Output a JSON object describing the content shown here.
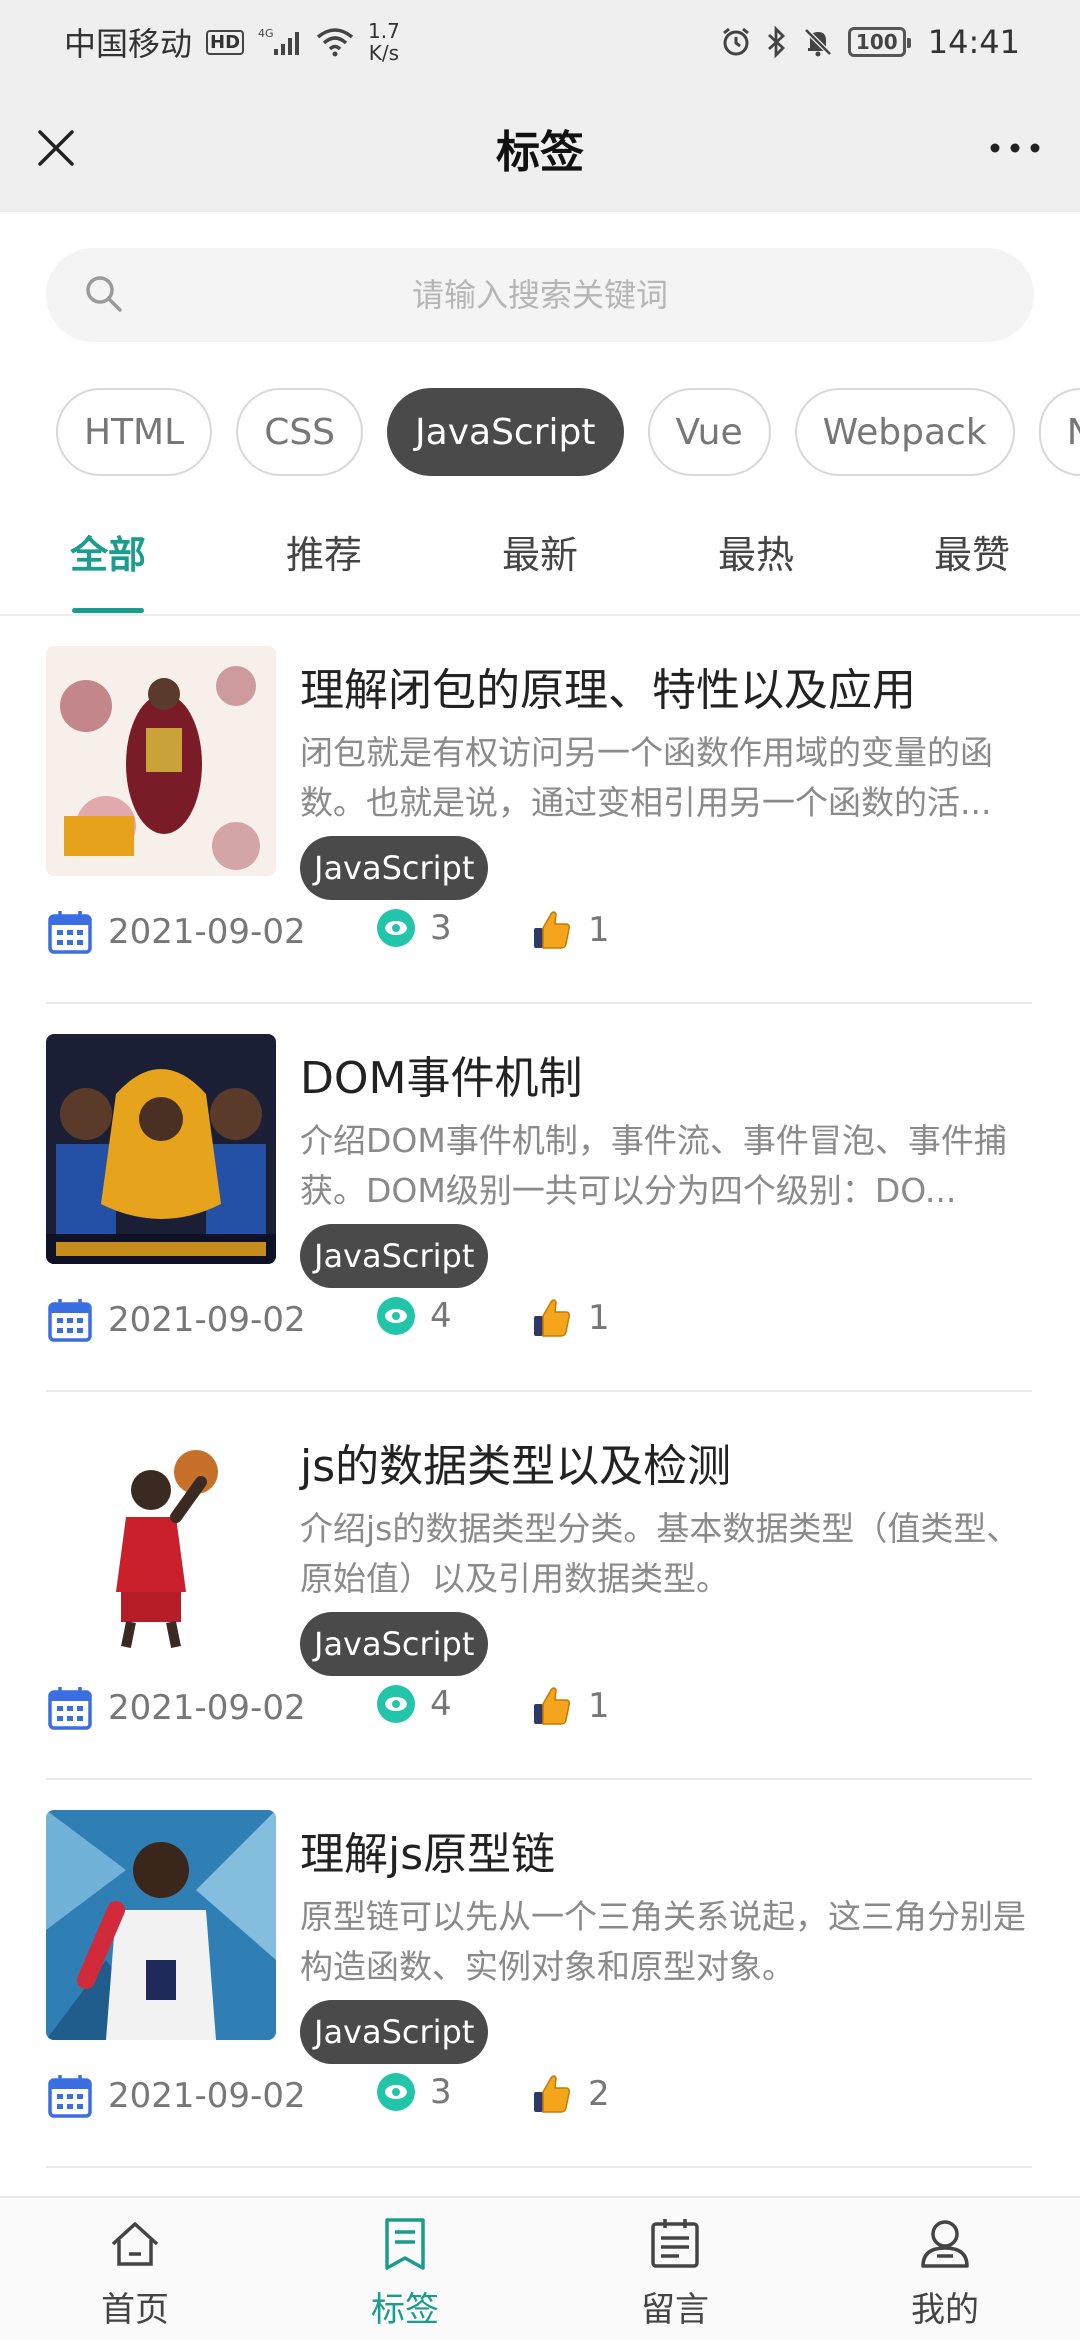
{
  "status_bar": {
    "carrier": "中国移动",
    "hd": "HD",
    "net_type": "4G",
    "speed_value": "1.7",
    "speed_unit": "K/s",
    "battery": "100",
    "time": "14:41"
  },
  "header": {
    "title": "标签"
  },
  "search": {
    "placeholder": "请输入搜索关键词"
  },
  "tags": [
    "HTML",
    "CSS",
    "JavaScript",
    "Vue",
    "Webpack",
    "N"
  ],
  "active_tag": "JavaScript",
  "sort_tabs": [
    "全部",
    "推荐",
    "最新",
    "最热",
    "最赞"
  ],
  "articles": [
    {
      "title": "理解闭包的原理、特性以及应用",
      "desc": "闭包就是有权访问另一个函数作用域的变量的函数。也就是说，通过变相引用另一个函数的活...",
      "tag": "JavaScript",
      "date": "2021-09-02",
      "views": "3",
      "likes": "1"
    },
    {
      "title": "DOM事件机制",
      "desc": "介绍DOM事件机制，事件流、事件冒泡、事件捕获。DOM级别一共可以分为四个级别：DO...",
      "tag": "JavaScript",
      "date": "2021-09-02",
      "views": "4",
      "likes": "1"
    },
    {
      "title": "js的数据类型以及检测",
      "desc": "介绍js的数据类型分类。基本数据类型（值类型、原始值）以及引用数据类型。",
      "tag": "JavaScript",
      "date": "2021-09-02",
      "views": "4",
      "likes": "1"
    },
    {
      "title": "理解js原型链",
      "desc": "原型链可以先从一个三角关系说起，这三角分别是构造函数、实例对象和原型对象。",
      "tag": "JavaScript",
      "date": "2021-09-02",
      "views": "3",
      "likes": "2"
    }
  ],
  "bottom_nav": [
    {
      "label": "首页",
      "icon": "home-icon"
    },
    {
      "label": "标签",
      "icon": "tag-doc-icon"
    },
    {
      "label": "留言",
      "icon": "message-board-icon"
    },
    {
      "label": "我的",
      "icon": "profile-icon"
    }
  ],
  "colors": {
    "accent": "#1a9c8e",
    "chip_active": "#4a4a4a",
    "header_bg": "#efefef"
  }
}
